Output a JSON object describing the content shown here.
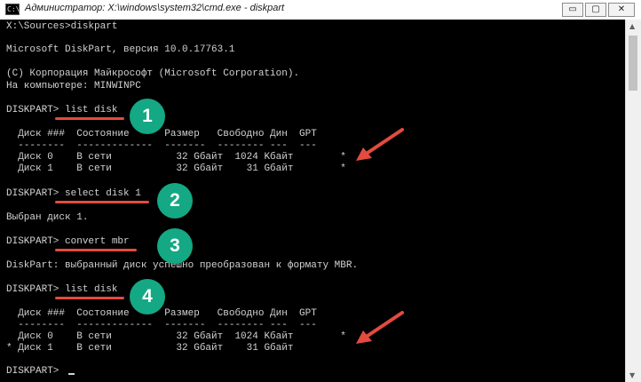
{
  "window": {
    "title": "Администратор: X:\\windows\\system32\\cmd.exe - diskpart",
    "minimize_glyph": "▭",
    "maximize_glyph": "▢",
    "close_glyph": "✕",
    "app_icon_glyph": "C:\\"
  },
  "console": {
    "lines": [
      "X:\\Sources>diskpart",
      "",
      "Microsoft DiskPart, версия 10.0.17763.1",
      "",
      "(C) Корпорация Майкрософт (Microsoft Corporation).",
      "На компьютере: MINWINPC",
      "",
      "DISKPART> list disk",
      "",
      "  Диск ###  Состояние      Размер   Свободно Дин  GPT",
      "  --------  -------------  -------  -------- ---  ---",
      "  Диск 0    В сети           32 Gбайт  1024 Kбайт        *",
      "  Диск 1    В сети           32 Gбайт    31 Gбайт        *",
      "",
      "DISKPART> select disk 1",
      "",
      "Выбран диск 1.",
      "",
      "DISKPART> convert mbr",
      "",
      "DiskPart: выбранный диск успешно преобразован к формату MBR.",
      "",
      "DISKPART> list disk",
      "",
      "  Диск ###  Состояние      Размер   Свободно Дин  GPT",
      "  --------  -------------  -------  -------- ---  ---",
      "  Диск 0    В сети           32 Gбайт  1024 Kбайт        *",
      "* Диск 1    В сети           32 Gбайт    31 Gбайт",
      "",
      "DISKPART> "
    ]
  },
  "annotations": {
    "badges": [
      "1",
      "2",
      "3",
      "4"
    ],
    "accent_color": "#14a884",
    "marker_color": "#e34b3f"
  },
  "scrollbar": {
    "up_glyph": "▲",
    "down_glyph": "▼"
  }
}
